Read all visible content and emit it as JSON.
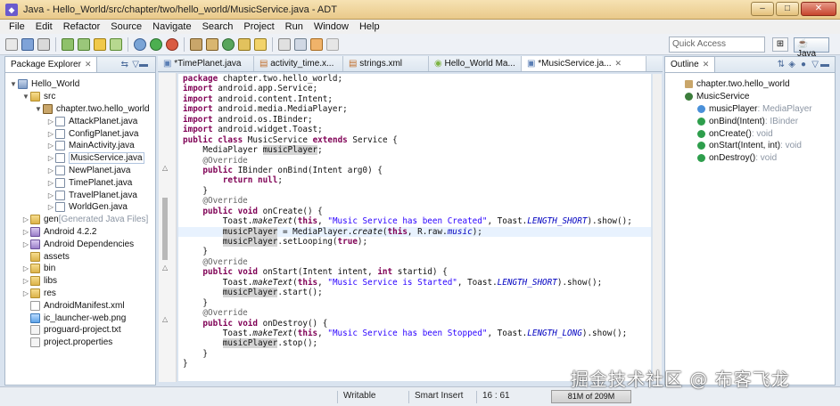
{
  "window": {
    "title": "Java - Hello_World/src/chapter/two/hello_world/MusicService.java - ADT",
    "controls": [
      "–",
      "□",
      "✕"
    ]
  },
  "menu": [
    "File",
    "Edit",
    "Refactor",
    "Source",
    "Navigate",
    "Search",
    "Project",
    "Run",
    "Window",
    "Help"
  ],
  "toolbar": {
    "quick_access_placeholder": "Quick Access",
    "perspective_label": "Java",
    "icons": [
      "new-icon",
      "save-icon",
      "print-icon",
      "sdk-manager-icon",
      "avd-manager-icon",
      "lint-icon",
      "new-android-project-icon",
      "debug-icon",
      "run-icon",
      "external-tools-icon",
      "new-java-project-icon",
      "new-package-icon",
      "new-class-icon",
      "open-type-icon",
      "search-icon",
      "annotation-icon",
      "next-annotation-icon",
      "back-icon",
      "forward-icon"
    ]
  },
  "package_explorer": {
    "tab_label": "Package Explorer",
    "items": [
      {
        "label": "Hello_World",
        "type": "project",
        "depth": 0,
        "arrow": "▼"
      },
      {
        "label": "src",
        "type": "folder",
        "depth": 1,
        "arrow": "▼"
      },
      {
        "label": "chapter.two.hello_world",
        "type": "package",
        "depth": 2,
        "arrow": "▼"
      },
      {
        "label": "AttackPlanet.java",
        "type": "java",
        "depth": 3,
        "arrow": "▷"
      },
      {
        "label": "ConfigPlanet.java",
        "type": "java",
        "depth": 3,
        "arrow": "▷"
      },
      {
        "label": "MainActivity.java",
        "type": "java",
        "depth": 3,
        "arrow": "▷"
      },
      {
        "label": "MusicService.java",
        "type": "java",
        "depth": 3,
        "arrow": "▷"
      },
      {
        "label": "NewPlanet.java",
        "type": "java",
        "depth": 3,
        "arrow": "▷"
      },
      {
        "label": "TimePlanet.java",
        "type": "java",
        "depth": 3,
        "arrow": "▷"
      },
      {
        "label": "TravelPlanet.java",
        "type": "java",
        "depth": 3,
        "arrow": "▷"
      },
      {
        "label": "WorldGen.java",
        "type": "java",
        "depth": 3,
        "arrow": "▷"
      },
      {
        "label": "gen",
        "suffix": " [Generated Java Files]",
        "type": "folder",
        "depth": 1,
        "arrow": "▷"
      },
      {
        "label": "Android 4.2.2",
        "type": "lib",
        "depth": 1,
        "arrow": "▷"
      },
      {
        "label": "Android Dependencies",
        "type": "lib",
        "depth": 1,
        "arrow": "▷"
      },
      {
        "label": "assets",
        "type": "folder",
        "depth": 1,
        "arrow": ""
      },
      {
        "label": "bin",
        "type": "folder",
        "depth": 1,
        "arrow": "▷"
      },
      {
        "label": "libs",
        "type": "folder",
        "depth": 1,
        "arrow": "▷"
      },
      {
        "label": "res",
        "type": "folder",
        "depth": 1,
        "arrow": "▷"
      },
      {
        "label": "AndroidManifest.xml",
        "type": "xml",
        "depth": 1,
        "arrow": ""
      },
      {
        "label": "ic_launcher-web.png",
        "type": "png",
        "depth": 1,
        "arrow": ""
      },
      {
        "label": "proguard-project.txt",
        "type": "file",
        "depth": 1,
        "arrow": ""
      },
      {
        "label": "project.properties",
        "type": "file",
        "depth": 1,
        "arrow": ""
      }
    ]
  },
  "editor": {
    "tabs": [
      "*TimePlanet.java",
      "activity_time.x...",
      "strings.xml",
      "Hello_World Ma...",
      "*MusicService.ja..."
    ],
    "active_tab": 4,
    "lines": [
      "package chapter.two.hello_world;",
      "import android.app.Service;",
      "import android.content.Intent;",
      "import android.media.MediaPlayer;",
      "import android.os.IBinder;",
      "import android.widget.Toast;",
      "public class MusicService extends Service {",
      "    MediaPlayer musicPlayer;",
      "    @Override",
      "    public IBinder onBind(Intent arg0) {",
      "        return null;",
      "    }",
      "    @Override",
      "    public void onCreate() {",
      "        Toast.makeText(this, \"Music Service has been Created\", Toast.LENGTH_SHORT).show();",
      "        musicPlayer = MediaPlayer.create(this, R.raw.music);",
      "        musicPlayer.setLooping(true);",
      "    }",
      "    @Override",
      "    public void onStart(Intent intent, int startid) {",
      "        Toast.makeText(this, \"Music Service is Started\", Toast.LENGTH_SHORT).show();",
      "        musicPlayer.start();",
      "    }",
      "    @Override",
      "    public void onDestroy() {",
      "        Toast.makeText(this, \"Music Service has been Stopped\", Toast.LENGTH_LONG).show();",
      "        musicPlayer.stop();",
      "    }",
      "}"
    ]
  },
  "outline": {
    "tab_label": "Outline",
    "items": [
      {
        "label": "chapter.two.hello_world",
        "detail": "",
        "kind": "package",
        "depth": 0
      },
      {
        "label": "MusicService",
        "detail": "",
        "kind": "class",
        "depth": 0
      },
      {
        "label": "musicPlayer",
        "detail": " : MediaPlayer",
        "kind": "field",
        "depth": 1
      },
      {
        "label": "onBind(Intent)",
        "detail": " : IBinder",
        "kind": "method",
        "depth": 1
      },
      {
        "label": "onCreate()",
        "detail": " : void",
        "kind": "method",
        "depth": 1
      },
      {
        "label": "onStart(Intent, int)",
        "detail": " : void",
        "kind": "method",
        "depth": 1
      },
      {
        "label": "onDestroy()",
        "detail": " : void",
        "kind": "method",
        "depth": 1
      }
    ]
  },
  "status": {
    "mode": "Writable",
    "insert": "Smart Insert",
    "position": "16 : 61",
    "memory": "81M of 209M"
  },
  "watermark": "掘金技术社区 @ 布客飞龙"
}
